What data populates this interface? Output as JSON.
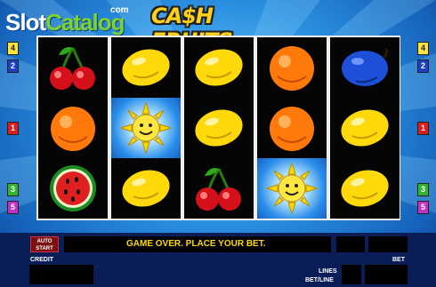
{
  "header": {
    "site_logo_main": "Slot",
    "site_logo_accent": "Catalog",
    "site_logo_suffix": "com",
    "game_title": "CA$H FRUITS"
  },
  "reels": [
    [
      "cherry",
      "orange",
      "watermelon"
    ],
    [
      "lemon",
      "sun",
      "lemon"
    ],
    [
      "lemon",
      "lemon",
      "cherry"
    ],
    [
      "orange",
      "orange",
      "sun"
    ],
    [
      "plum",
      "lemon",
      "lemon"
    ]
  ],
  "paylines_left": [
    "4",
    "2",
    "1",
    "3",
    "5"
  ],
  "paylines_right": [
    "4",
    "2",
    "1",
    "3",
    "5"
  ],
  "panel": {
    "autostart_label_1": "AUTO",
    "autostart_label_2": "START",
    "message": "GAME OVER. PLACE YOUR BET.",
    "credit_label": "CREDIT",
    "lines_label": "LINES",
    "bet_per_line_label": "BET/LINE",
    "bet_label": "BET"
  },
  "colors": {
    "background": "#2a8fe0",
    "reel_background": "#050505",
    "panel_background": "#0b1d57",
    "message_text": "#ffd800"
  }
}
